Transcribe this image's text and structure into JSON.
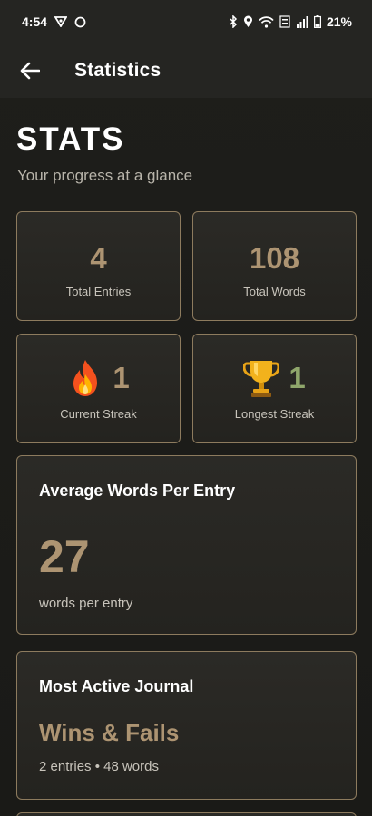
{
  "status_bar": {
    "time": "4:54",
    "battery": "21%",
    "icons": [
      "vpn-icon",
      "sync-icon",
      "bluetooth-icon",
      "location-icon",
      "wifi-icon",
      "volte-icon",
      "signal-icon",
      "battery-icon"
    ]
  },
  "app_bar": {
    "back_icon": "arrow-left-icon",
    "title": "Statistics"
  },
  "header": {
    "title": "STATS",
    "subtitle": "Your progress at a glance"
  },
  "stats": {
    "total_entries": {
      "value": "4",
      "label": "Total Entries"
    },
    "total_words": {
      "value": "108",
      "label": "Total Words"
    },
    "current_streak": {
      "value": "1",
      "label": "Current Streak",
      "icon": "fire-icon",
      "color": "#ad9472"
    },
    "longest_streak": {
      "value": "1",
      "label": "Longest Streak",
      "icon": "trophy-icon",
      "color": "#8fa66b"
    }
  },
  "average_card": {
    "title": "Average Words Per Entry",
    "value": "27",
    "caption": "words per entry"
  },
  "active_journal_card": {
    "title": "Most Active Journal",
    "name": "Wins & Fails",
    "meta": "2 entries • 48 words"
  },
  "colors": {
    "accent": "#ad9472",
    "border": "#8d7b5e",
    "background": "#1c1c19",
    "green": "#8fa66b"
  }
}
